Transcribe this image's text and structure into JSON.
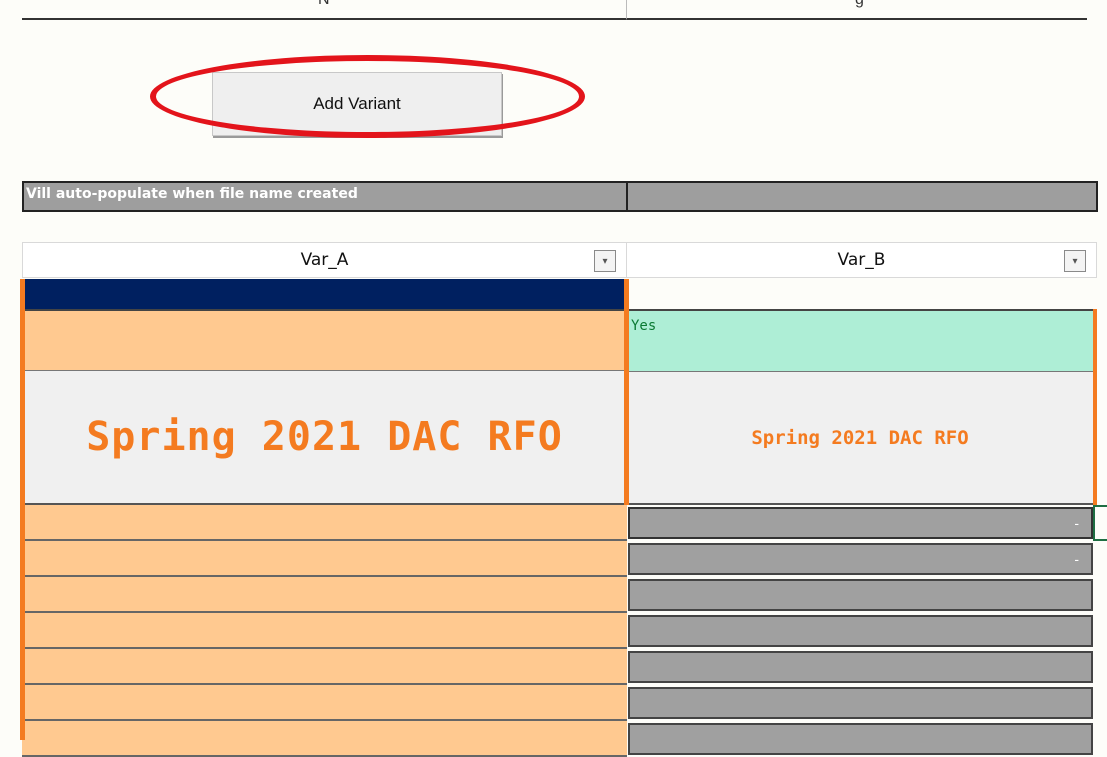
{
  "top_row": {
    "col_a_clipped": "N",
    "col_b_clipped": "g"
  },
  "add_variant": {
    "label": "Add Variant"
  },
  "info_bar": {
    "text": "Vill auto-populate when file name created",
    "col_b_text": ""
  },
  "columns": [
    {
      "header": "Var_A",
      "filter_icon": "dropdown-arrow-icon"
    },
    {
      "header": "Var_B",
      "filter_icon": "dropdown-arrow-icon"
    }
  ],
  "var_a": {
    "title": "Spring 2021 DAC RFO"
  },
  "var_b": {
    "status": "Yes",
    "title": "Spring 2021 DAC RFO"
  },
  "var_b_rows": [
    "-",
    "-",
    "",
    "",
    "",
    "",
    ""
  ],
  "colors": {
    "accent_orange": "#f47b20",
    "orange_fill": "#ffc990",
    "navy": "#002060",
    "mint": "#aeeed6",
    "grey_cell": "#a0a0a0",
    "highlight_red": "#e3141b"
  }
}
